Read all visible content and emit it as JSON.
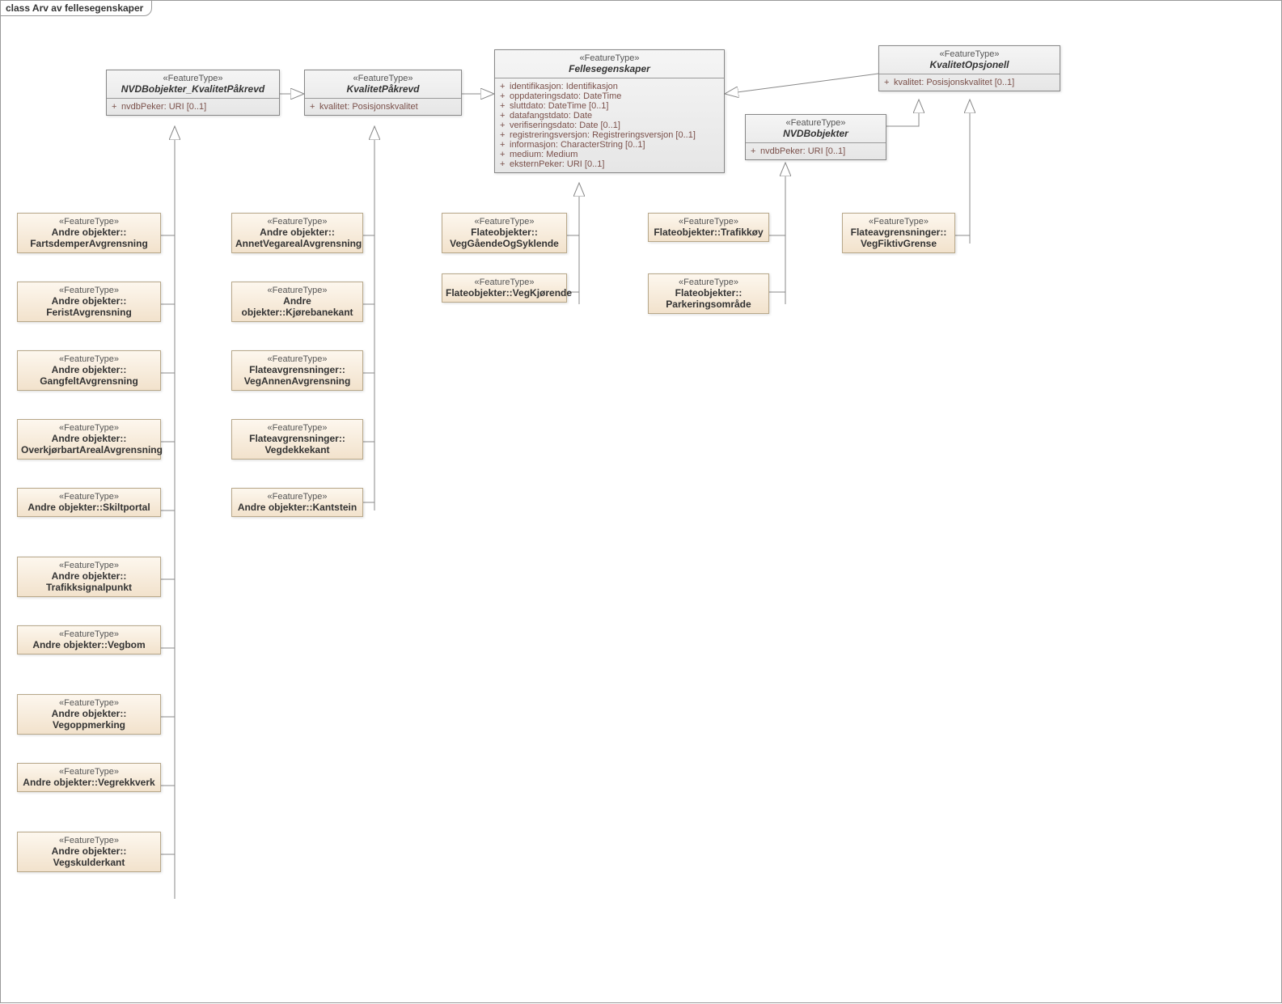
{
  "frame": {
    "keyword": "class",
    "title": "Arv av fellesegenskaper"
  },
  "stereo": "«FeatureType»",
  "classes": {
    "nvdb_kvalitet": {
      "name": "NVDBobjekter_KvalitetPåkrevd",
      "attrs": [
        "nvdbPeker: URI [0..1]"
      ]
    },
    "kvalitet_paakrevd": {
      "name": "KvalitetPåkrevd",
      "attrs": [
        "kvalitet: Posisjonskvalitet"
      ]
    },
    "felles": {
      "name": "Fellesegenskaper",
      "attrs": [
        "identifikasjon: Identifikasjon",
        "oppdateringsdato: DateTime",
        "sluttdato: DateTime [0..1]",
        "datafangstdato: Date",
        "verifiseringsdato: Date [0..1]",
        "registreringsversjon: Registreringsversjon [0..1]",
        "informasjon: CharacterString [0..1]",
        "medium: Medium",
        "eksternPeker: URI [0..1]"
      ]
    },
    "kvalitet_opsjonell": {
      "name": "KvalitetOpsjonell",
      "attrs": [
        "kvalitet: Posisjonskvalitet [0..1]"
      ]
    },
    "nvdb_obj": {
      "name": "NVDBobjekter",
      "attrs": [
        "nvdbPeker: URI [0..1]"
      ]
    }
  },
  "left_children": [
    "Andre objekter::\nFartsdemperAvgrensning",
    "Andre objekter::\nFeristAvgrensning",
    "Andre objekter::\nGangfeltAvgrensning",
    "Andre objekter::\nOverkjørbartArealAvgrensning",
    "Andre objekter::Skiltportal",
    "Andre objekter::\nTrafikksignalpunkt",
    "Andre objekter::Vegbom",
    "Andre objekter::\nVegoppmerking",
    "Andre objekter::Vegrekkverk",
    "Andre objekter::\nVegskulderkant"
  ],
  "mid_children": [
    "Andre objekter::\nAnnetVegarealAvgrensning",
    "Andre objekter::Kjørebanekant",
    "Flateavgrensninger::\nVegAnnenAvgrensning",
    "Flateavgrensninger::\nVegdekkekant",
    "Andre objekter::Kantstein"
  ],
  "felles_children": [
    "Flateobjekter::\nVegGåendeOgSyklende",
    "Flateobjekter::VegKjørende"
  ],
  "nvdb_children": [
    "Flateobjekter::Trafikkøy",
    "Flateobjekter::\nParkeringsområde"
  ],
  "opsjonell_children": [
    "Flateavgrensninger::\nVegFiktivGrense"
  ]
}
